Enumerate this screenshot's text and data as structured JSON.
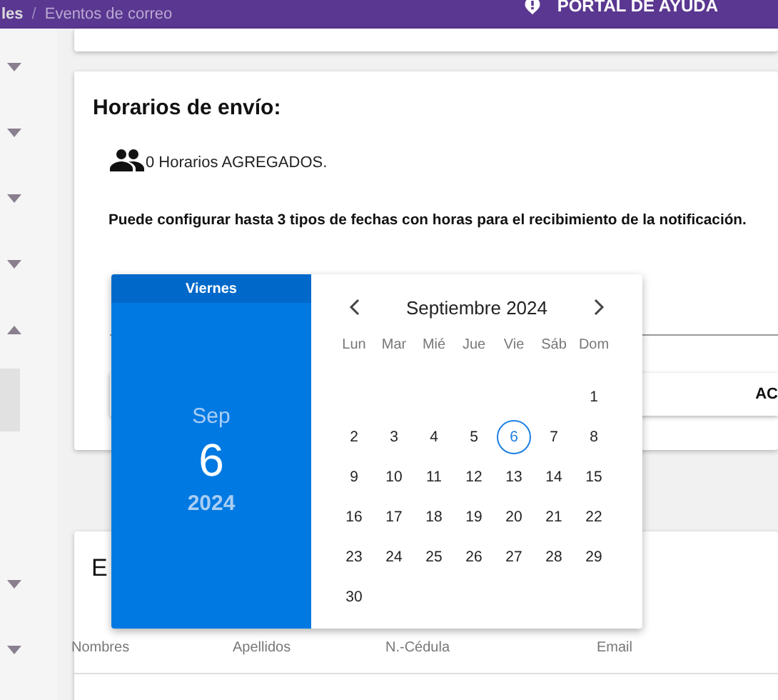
{
  "topbar": {
    "breadcrumb": [
      "les",
      "Eventos de correo"
    ],
    "separator": "/",
    "help_button": "PORTAL DE AYUDA"
  },
  "sidebar": {
    "items": [
      {
        "expanded": false
      },
      {
        "expanded": false
      },
      {
        "expanded": false
      },
      {
        "expanded": false
      },
      {
        "expanded": true,
        "children": [
          {
            "selected": true
          }
        ]
      },
      {
        "expanded": false
      },
      {
        "expanded": false
      }
    ]
  },
  "schedule_card": {
    "title": "Horarios de envío:",
    "count_text": "0 Horarios AGREGADOS.",
    "notice": "Puede configurar hasta 3 tipos de fechas con horas para el recibimiento de la notificación.",
    "action_header": "AC"
  },
  "recipients_card": {
    "title": "E",
    "columns": [
      "Nombres",
      "Apellidos",
      "N.-Cédula",
      "Email"
    ]
  },
  "date_picker": {
    "weekday": "Viernes",
    "month": "Sep",
    "day": "6",
    "year": "2024",
    "month_title": "Septiembre 2024",
    "weekday_names": [
      "Lun",
      "Mar",
      "Mié",
      "Jue",
      "Vie",
      "Sáb",
      "Dom"
    ],
    "first_week": [
      {
        "label": "1",
        "selected": false
      }
    ],
    "weeks": [
      {
        "days": [
          {
            "label": "2",
            "selected": false
          },
          {
            "label": "3",
            "selected": false
          },
          {
            "label": "4",
            "selected": false
          },
          {
            "label": "5",
            "selected": false
          },
          {
            "label": "6",
            "selected": true
          },
          {
            "label": "7",
            "selected": false
          },
          {
            "label": "8",
            "selected": false
          }
        ]
      },
      {
        "days": [
          {
            "label": "9",
            "selected": false
          },
          {
            "label": "10",
            "selected": false
          },
          {
            "label": "11",
            "selected": false
          },
          {
            "label": "12",
            "selected": false
          },
          {
            "label": "13",
            "selected": false
          },
          {
            "label": "14",
            "selected": false
          },
          {
            "label": "15",
            "selected": false
          }
        ]
      },
      {
        "days": [
          {
            "label": "16",
            "selected": false
          },
          {
            "label": "17",
            "selected": false
          },
          {
            "label": "18",
            "selected": false
          },
          {
            "label": "19",
            "selected": false
          },
          {
            "label": "20",
            "selected": false
          },
          {
            "label": "21",
            "selected": false
          },
          {
            "label": "22",
            "selected": false
          }
        ]
      },
      {
        "days": [
          {
            "label": "23",
            "selected": false
          },
          {
            "label": "24",
            "selected": false
          },
          {
            "label": "25",
            "selected": false
          },
          {
            "label": "26",
            "selected": false
          },
          {
            "label": "27",
            "selected": false
          },
          {
            "label": "28",
            "selected": false
          },
          {
            "label": "29",
            "selected": false
          }
        ]
      },
      {
        "days": [
          {
            "label": "30",
            "selected": false
          }
        ]
      }
    ]
  }
}
